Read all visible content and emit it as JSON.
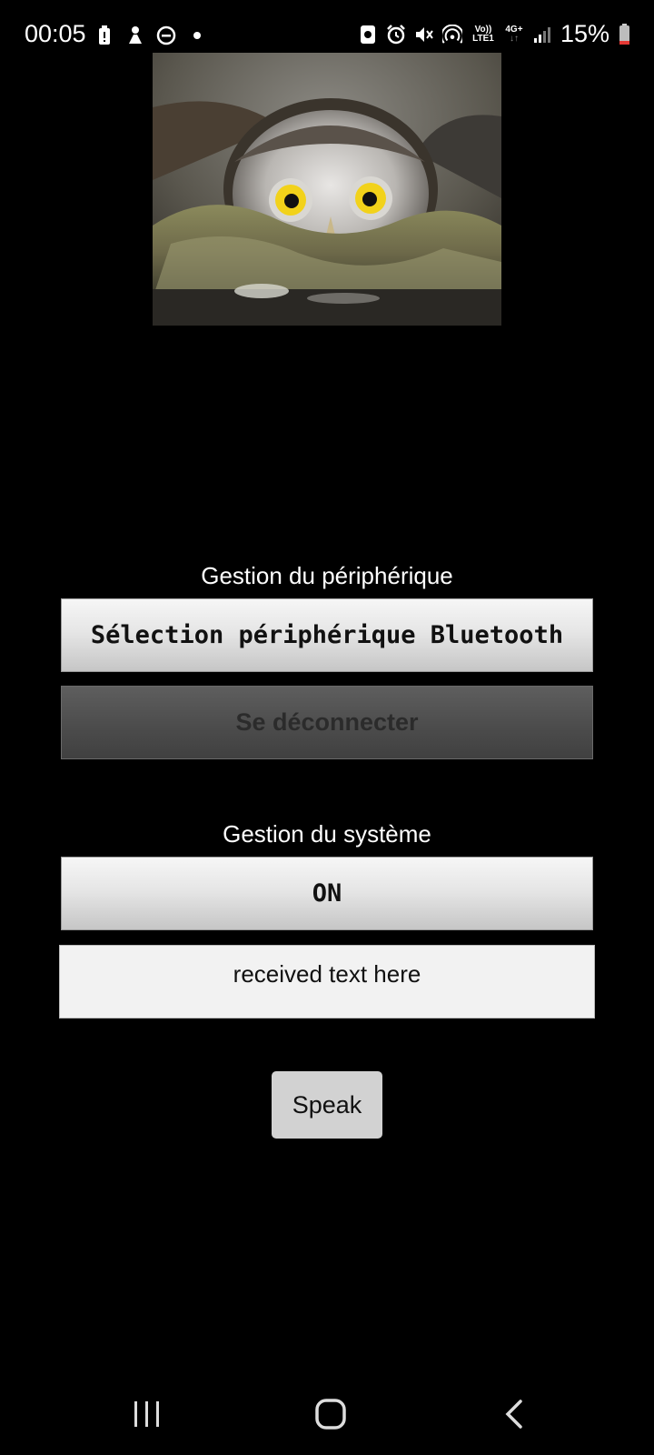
{
  "status_bar": {
    "time": "00:05",
    "battery_percent": "15%",
    "network_label_top": "Vo))",
    "network_label_bottom": "LTE1",
    "network_type": "4G+",
    "left_icons": [
      "battery-saver-icon",
      "gesture-icon",
      "dnd-icon",
      "dot-icon"
    ],
    "right_icons": [
      "cast-icon",
      "alarm-icon",
      "mute-icon",
      "hotspot-icon",
      "volte-icon",
      "4g-icon",
      "signal-icon",
      "battery-icon"
    ]
  },
  "image": {
    "subject": "owl-image"
  },
  "device_section": {
    "title": "Gestion du périphérique",
    "select_button": "Sélection périphérique Bluetooth",
    "disconnect_button": "Se déconnecter"
  },
  "system_section": {
    "title": "Gestion du système",
    "toggle_button": "ON",
    "received_text": "received text here"
  },
  "speak_button": "Speak",
  "colors": {
    "background": "#000000",
    "light_button": "#e0e0e0",
    "dark_button": "#4b4b4b",
    "battery_low": "#e53935"
  }
}
